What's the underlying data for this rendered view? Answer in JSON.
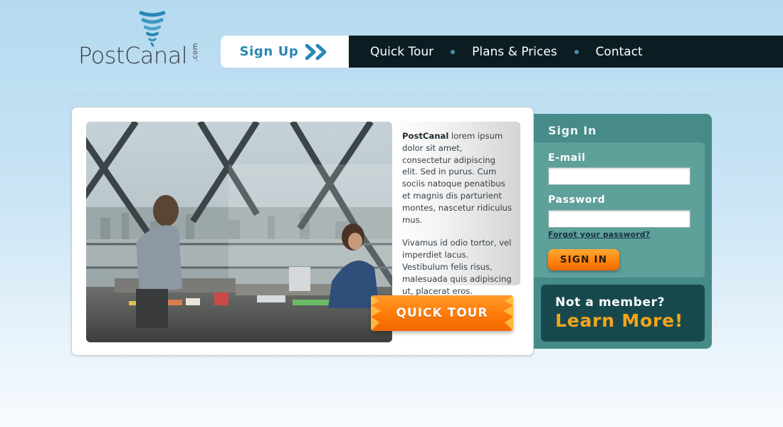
{
  "logo": {
    "name": "PostCanal",
    "suffix": ".com"
  },
  "nav": {
    "signup_label": "Sign Up",
    "links": [
      {
        "label": "Quick Tour"
      },
      {
        "label": "Plans & Prices"
      },
      {
        "label": "Contact"
      }
    ]
  },
  "hero": {
    "brand": "PostCanal",
    "paragraph1": "lorem ipsum dolor sit amet, consectetur adipiscing elit. Sed in purus. Cum sociis natoque penatibus et magnis dis parturient montes, nascetur ridiculus mus.",
    "paragraph2": "Vivamus id odio tortor, vel imperdiet lacus. Vestibulum felis risus, malesuada quis adipiscing ut, placerat eros.",
    "cta_label": "QUICK TOUR"
  },
  "signin": {
    "title": "Sign In",
    "email_label": "E-mail",
    "email_value": "",
    "password_label": "Password",
    "password_value": "",
    "forgot_label": "Forgot your password?",
    "button_label": "SIGN IN"
  },
  "member": {
    "line1": "Not a member?",
    "line2": "Learn More!"
  },
  "colors": {
    "brand_blue": "#2a87b4",
    "nav_dark": "#0b1d22",
    "panel_teal": "#468b88",
    "form_teal": "#5ea09a",
    "member_dark": "#17494c",
    "accent_orange": "#ff7a08",
    "learn_more_yellow": "#f6a41a"
  }
}
